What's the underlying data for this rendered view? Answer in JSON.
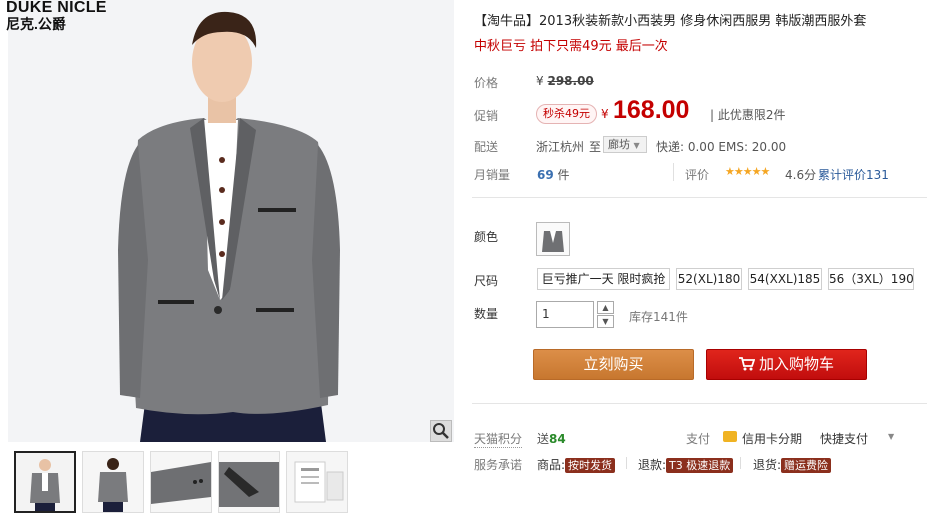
{
  "brand": {
    "en": "DUKE NICLE",
    "cn": "尼克.公爵"
  },
  "product": {
    "title": "【淘牛品】2013秋装新款小西装男 修身休闲西服男 韩版潮西服外套",
    "subtitle": "中秋巨亏 拍下只需49元 最后一次"
  },
  "price": {
    "label": "价格",
    "yen": "¥",
    "original": "298.00"
  },
  "promo": {
    "label": "促销",
    "tag": "秒杀49元",
    "yen": "¥",
    "current": "168.00",
    "limit": "| 此优惠限2件"
  },
  "delivery": {
    "label": "配送",
    "from": "浙江杭州",
    "to_word": "至",
    "city": "廊坊",
    "fees": "快递: 0.00  EMS: 20.00"
  },
  "sales": {
    "label": "月销量",
    "count": "69",
    "unit": "件",
    "rating_label": "评价",
    "stars": "★★★★★",
    "score": "4.6分",
    "reviews": "累计评价131"
  },
  "color": {
    "label": "颜色"
  },
  "size": {
    "label": "尺码",
    "options": [
      "巨亏推广一天 限时疯抢",
      "52(XL)180",
      "54(XXL)185",
      "56（3XL）190"
    ]
  },
  "quantity": {
    "label": "数量",
    "value": "1",
    "stock": "库存141件"
  },
  "actions": {
    "buy_now": "立刻购买",
    "add_cart": "加入购物车"
  },
  "points": {
    "label": "天猫积分",
    "send_prefix": "送",
    "send_value": "84"
  },
  "payment": {
    "label": "支付",
    "credit": "信用卡分期",
    "quick": "快捷支付"
  },
  "service": {
    "label": "服务承诺",
    "goods": "商品:",
    "goods_badge": "按时发货",
    "refund": "退款:",
    "refund_badge": "T3 极速退款",
    "return": "退货:",
    "return_badge": "赠运费险"
  },
  "colors": {
    "accent_red": "#c40000",
    "buy_orange": "#cf7f3a",
    "cart_red": "#c10d0d",
    "green": "#2a8a2a",
    "star": "#f5a623"
  }
}
